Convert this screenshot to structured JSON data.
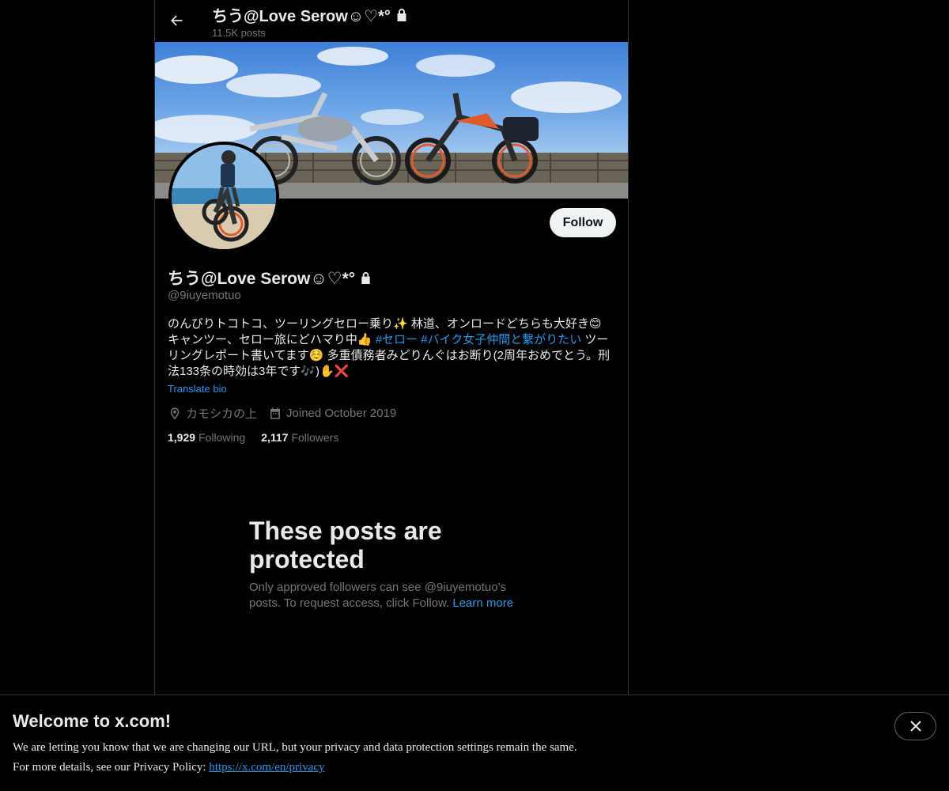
{
  "header": {
    "title": "ちう@Love Serow☺♡*°",
    "posts_count": "11.5K posts"
  },
  "profile": {
    "display_name": "ちう@Love Serow☺♡*°",
    "handle": "@9iuyemotuo",
    "follow_label": "Follow",
    "bio_part1": "のんびりトコトコ、ツーリングセロー乗り✨ 林道、オンロードどちらも大好き😊 キャンツー、セロー旅にどハマり中👍 ",
    "bio_tag1": "#セロー",
    "bio_space": " ",
    "bio_tag2": "#バイク女子仲間と繋がりたい",
    "bio_part2": " ツーリングレポート書いてます☺️ 多重債務者みどりんぐはお断り(2周年おめでとう。刑法133条の時効は3年です🎶)✋❌",
    "translate_label": "Translate bio",
    "location": "カモシカの上",
    "joined": "Joined October 2019",
    "following_count": "1,929",
    "following_label": "Following",
    "followers_count": "2,117",
    "followers_label": "Followers"
  },
  "protected": {
    "title": "These posts are protected",
    "text": "Only approved followers can see @9iuyemotuo’s posts. To request access, click Follow.",
    "link": "Learn more"
  },
  "welcome": {
    "title": "Welcome to x.com!",
    "line1": "We are letting you know that we are changing our URL, but your privacy and data protection settings remain the same.",
    "line2_prefix": "For more details, see our Privacy Policy:",
    "link": "https://x.com/en/privacy"
  },
  "icons": {
    "back": "arrow-left-icon",
    "lock": "lock-icon",
    "location": "location-pin-icon",
    "calendar": "calendar-icon",
    "close": "close-icon"
  },
  "colors": {
    "background": "#000000",
    "text": "#e7e9ea",
    "muted": "#71767b",
    "accent": "#1d9bf0",
    "border": "#2f3336"
  }
}
